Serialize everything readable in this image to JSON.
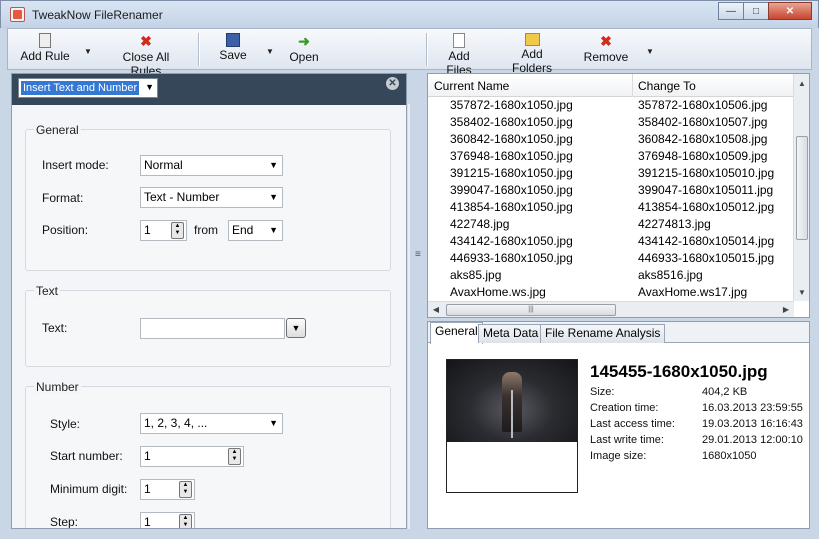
{
  "window": {
    "title": "TweakNow FileRenamer"
  },
  "toolbar": {
    "add_rule": "Add Rule",
    "close_all_rules": "Close All Rules",
    "save": "Save",
    "open": "Open",
    "add_files": "Add Files",
    "add_folders": "Add Folders",
    "remove": "Remove"
  },
  "rule": {
    "selected": "Insert Text and Number",
    "general": {
      "title": "General",
      "insert_mode_label": "Insert mode:",
      "insert_mode_value": "Normal",
      "format_label": "Format:",
      "format_value": "Text - Number",
      "position_label": "Position:",
      "position_value": "1",
      "from_label": "from",
      "from_value": "End"
    },
    "text": {
      "title": "Text",
      "text_label": "Text:",
      "text_value": ""
    },
    "number": {
      "title": "Number",
      "style_label": "Style:",
      "style_value": "1, 2, 3, 4, ...",
      "start_label": "Start number:",
      "start_value": "1",
      "min_digit_label": "Minimum digit:",
      "min_digit_value": "1",
      "step_label": "Step:",
      "step_value": "1"
    }
  },
  "file_list": {
    "col_current": "Current Name",
    "col_change": "Change To",
    "rows": [
      {
        "current": "357872-1680x1050.jpg",
        "change": "357872-1680x10506.jpg"
      },
      {
        "current": "358402-1680x1050.jpg",
        "change": "358402-1680x10507.jpg"
      },
      {
        "current": "360842-1680x1050.jpg",
        "change": "360842-1680x10508.jpg"
      },
      {
        "current": "376948-1680x1050.jpg",
        "change": "376948-1680x10509.jpg"
      },
      {
        "current": "391215-1680x1050.jpg",
        "change": "391215-1680x105010.jpg"
      },
      {
        "current": "399047-1680x1050.jpg",
        "change": "399047-1680x105011.jpg"
      },
      {
        "current": "413854-1680x1050.jpg",
        "change": "413854-1680x105012.jpg"
      },
      {
        "current": "422748.jpg",
        "change": "42274813.jpg"
      },
      {
        "current": "434142-1680x1050.jpg",
        "change": "434142-1680x105014.jpg"
      },
      {
        "current": "446933-1680x1050.jpg",
        "change": "446933-1680x105015.jpg"
      },
      {
        "current": "aks85.jpg",
        "change": "aks8516.jpg"
      },
      {
        "current": "AvaxHome.ws.jpg",
        "change": "AvaxHome.ws17.jpg"
      }
    ]
  },
  "info": {
    "tabs": [
      "General",
      "Meta Data",
      "File Rename Analysis"
    ],
    "filename": "145455-1680x1050.jpg",
    "fields": [
      {
        "label": "Size:",
        "value": "404,2 KB"
      },
      {
        "label": "Creation time:",
        "value": "16.03.2013 23:59:55"
      },
      {
        "label": "Last access time:",
        "value": "19.03.2013 16:16:43"
      },
      {
        "label": "Last write time:",
        "value": "29.01.2013 12:00:10"
      },
      {
        "label": "Image size:",
        "value": "1680x1050"
      }
    ]
  },
  "icons": {
    "add_rule": "clipboard-icon",
    "close_all_rules": "red-x-icon",
    "save": "floppy-icon",
    "open": "open-arrow-icon",
    "add_files": "document-icon",
    "add_folders": "folder-icon",
    "remove": "red-x-icon"
  },
  "colors": {
    "rule_header": "#36475a",
    "selection": "#3478d4",
    "remove_red": "#d12b1e"
  }
}
